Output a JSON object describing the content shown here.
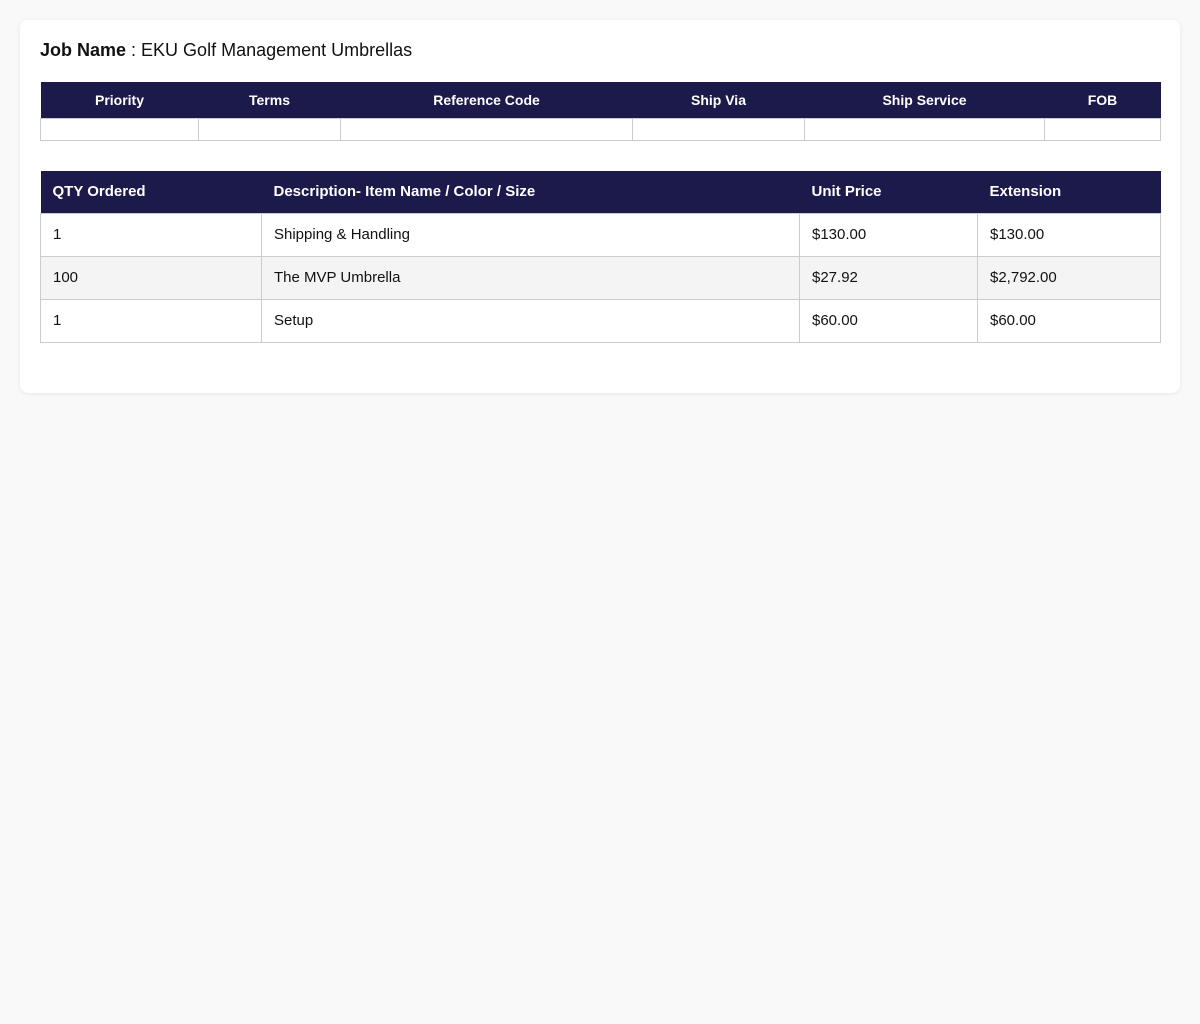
{
  "job": {
    "label": "Job Name",
    "separator": " : ",
    "value": "EKU Golf Management Umbrellas"
  },
  "meta_table": {
    "headers": [
      "Priority",
      "Terms",
      "Reference Code",
      "Ship Via",
      "Ship Service",
      "FOB"
    ],
    "row": [
      "",
      "",
      "",
      "",
      "",
      ""
    ]
  },
  "items_table": {
    "headers": [
      "QTY Ordered",
      "Description- Item Name / Color / Size",
      "Unit Price",
      "Extension"
    ],
    "rows": [
      {
        "qty": "1",
        "description": "Shipping & Handling",
        "unit_price": "$130.00",
        "extension": "$130.00"
      },
      {
        "qty": "100",
        "description": "The MVP Umbrella",
        "unit_price": "$27.92",
        "extension": "$2,792.00"
      },
      {
        "qty": "1",
        "description": "Setup",
        "unit_price": "$60.00",
        "extension": "$60.00"
      }
    ]
  },
  "colors": {
    "header_bg": "#1c1a4b",
    "header_text": "#ffffff",
    "alt_row_bg": "#f4f4f4"
  }
}
